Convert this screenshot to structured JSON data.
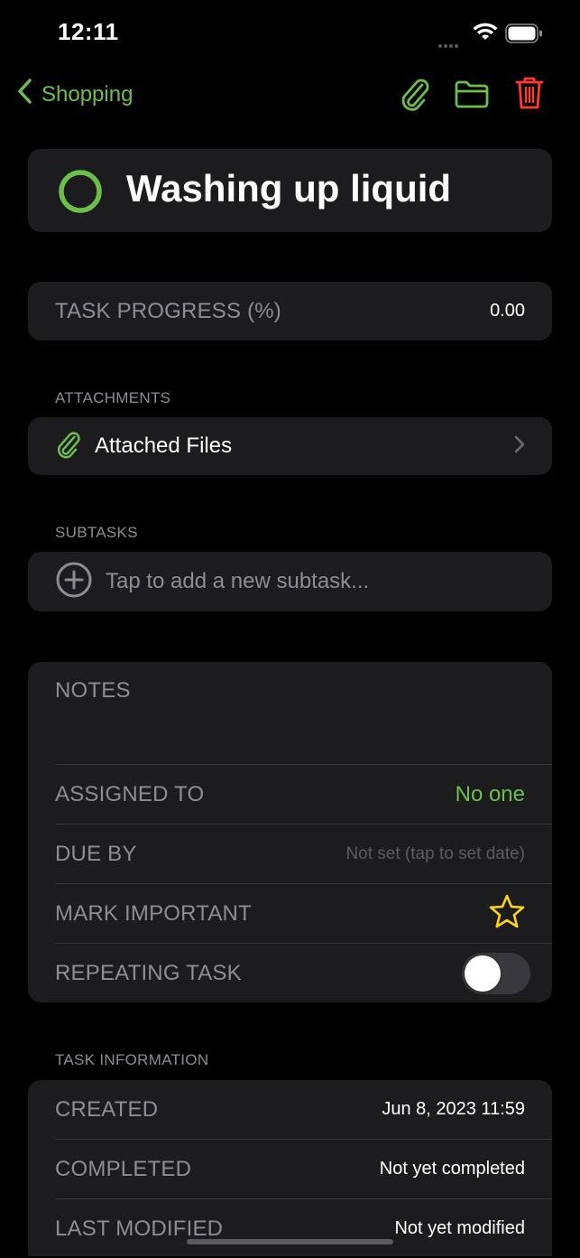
{
  "status_bar": {
    "time": "12:11"
  },
  "nav": {
    "back_label": "Shopping",
    "accent_color": "#6cc04a",
    "delete_color": "#ff3b30",
    "icons": [
      "paperclip-icon",
      "folder-icon",
      "trash-icon"
    ]
  },
  "task": {
    "title": "Washing up liquid"
  },
  "progress": {
    "label": "TASK PROGRESS (%)",
    "value": "0.00"
  },
  "attachments": {
    "header": "ATTACHMENTS",
    "row_label": "Attached Files"
  },
  "subtasks": {
    "header": "SUBTASKS",
    "placeholder": "Tap to add a new subtask..."
  },
  "details": {
    "notes_label": "NOTES",
    "assigned_label": "ASSIGNED TO",
    "assigned_value": "No one",
    "due_label": "DUE BY",
    "due_value": "Not set (tap to set date)",
    "important_label": "MARK IMPORTANT",
    "repeating_label": "REPEATING TASK",
    "repeating_on": false,
    "star_color": "#ffd60a"
  },
  "info": {
    "header": "TASK INFORMATION",
    "created_label": "CREATED",
    "created_value": "Jun 8, 2023 11:59",
    "completed_label": "COMPLETED",
    "completed_value": "Not yet completed",
    "modified_label": "LAST MODIFIED",
    "modified_value": "Not yet modified"
  }
}
